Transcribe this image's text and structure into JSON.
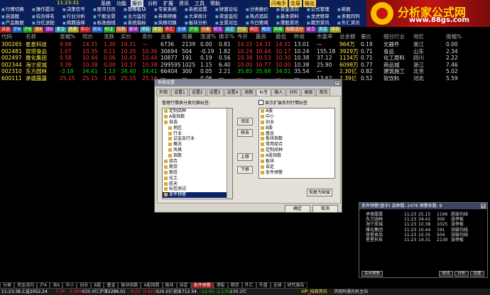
{
  "titlebar": {
    "time": "11:23:31",
    "menu": [
      "系统",
      "功能",
      "报价",
      "分析",
      "扩展",
      "资讯",
      "工具",
      "帮助"
    ],
    "right": [
      "闪电手",
      "交易",
      "输出"
    ]
  },
  "toolbar": {
    "items": [
      "行情切换",
      "操作提示",
      "决策信号",
      "股市日历",
      "策略板块",
      "专家系统",
      "系统设置",
      "财富论坛",
      "分类报价",
      "资金流向",
      "公式管理",
      "新股",
      "自选股",
      "综合排名",
      "行业分析",
      "个股全景",
      "主力监控",
      "券商研报",
      "大单统计",
      "资金监控",
      "热点追踪",
      "基本资料",
      "龙虎榜单",
      "多股同列",
      "产品数据",
      "分红送配",
      "周期选择",
      "标准画线",
      "系统指标",
      "风格切换",
      "板块分析",
      "全景对比",
      "今日要闻",
      "港股资讯",
      "期货资讯",
      "外汇资讯"
    ]
  },
  "logo": {
    "title": "分析家公式网",
    "url": "www.88gs.com"
  },
  "strip": {
    "items": [
      "自选",
      "沪A",
      "沪B",
      "深A",
      "深B",
      "基金",
      "债券",
      "中小",
      "创业",
      "权证",
      "指数",
      "板块",
      "港股",
      "期货",
      "外汇",
      "全球",
      "沪深",
      "分类",
      "综合",
      "自定",
      "行业",
      "地区",
      "概念",
      "风格",
      "指数成分",
      "组合",
      "资金",
      "排名"
    ],
    "colors": [
      "#c02020",
      "#2060c0",
      "#20a020",
      "#c06020",
      "#8020a0",
      "#2090a0",
      "#a0a020"
    ]
  },
  "table": {
    "headers": [
      "代码",
      "名称",
      "涨幅%",
      "现价",
      "涨跌",
      "买价",
      "卖价",
      "总量",
      "现量",
      "涨速%",
      "换手%",
      "今开",
      "最高",
      "最低",
      "昨收",
      "市盈率",
      "总金额",
      "量比",
      "细分行业",
      "地区",
      "振幅%"
    ],
    "rows": [
      [
        "300265",
        "星星科技",
        "9.99",
        "14.31",
        "1.30",
        "14.31",
        "—",
        "6736",
        "2139",
        "0.00",
        "0.81",
        "14.31",
        "14.31",
        "14.31",
        "13.01",
        "—",
        "964万",
        "0.19",
        "光器件",
        "浙江",
        "0.00"
      ],
      [
        "002481",
        "双塔食品",
        "1.07",
        "10.35",
        "0.11",
        "10.35",
        "10.36",
        "30694",
        "504",
        "-0.19",
        "1.82",
        "10.24",
        "10.44",
        "10.17",
        "10.24",
        "155.18",
        "3929万",
        "0.71",
        "食品",
        "山东",
        "2.34"
      ],
      [
        "002497",
        "雅化集团",
        "0.58",
        "10.44",
        "0.06",
        "10.43",
        "10.44",
        "10877",
        "191",
        "0.19",
        "0.56",
        "10.38",
        "10.53",
        "10.30",
        "10.38",
        "37.12",
        "1134万",
        "0.71",
        "化工原料",
        "四川",
        "2.22"
      ],
      [
        "002344",
        "海宁皮城",
        "3.39",
        "10.38",
        "0.00",
        "10.37",
        "10.38",
        "299595",
        "1025",
        "1.15",
        "6.40",
        "10.00",
        "10.77",
        "10.00",
        "10.38",
        "25.90",
        "6098万",
        "0.77",
        "商品城",
        "浙江",
        "7.46"
      ],
      [
        "002310",
        "东方园林",
        "-3.18",
        "34.41",
        "1.13",
        "34.40",
        "34.41",
        "66404",
        "300",
        "0.05",
        "2.21",
        "35.85",
        "35.68",
        "34.01",
        "35.54",
        "—",
        "2.30亿",
        "0.82",
        "建筑施工",
        "北京",
        "5.02"
      ],
      [
        "600111",
        "承德露露",
        "25.15",
        "25.15",
        "1.65",
        "25.15",
        "25.16",
        "—",
        "—",
        "0.06",
        "—",
        "—",
        "—",
        "—",
        "—",
        "13.62",
        "2.39亿",
        "0.52",
        "软饮料",
        "河北",
        "5.59"
      ]
    ],
    "colors": {
      "up": "#ff3333",
      "down": "#00dd00",
      "flat": "#dddddd",
      "code": "#ffee44",
      "name": "#ffee44"
    }
  },
  "dialog": {
    "title": "系统设置",
    "tabs": [
      "外观",
      "设置1",
      "设置2",
      "设置3",
      "设置4",
      "周期",
      "标签",
      "输入",
      "分栏",
      "高级",
      "首页"
    ],
    "active_tab": "标签",
    "left_label": "管理行情表分类切换标签:",
    "left_items": [
      "定制品种",
      "A股指数",
      "自选",
      "地区",
      "行业",
      "证监会行业",
      "概念",
      "风格",
      "指数",
      "组合",
      "期货",
      "期货",
      "化工",
      "航天",
      "标签测试",
      "条件预警"
    ],
    "selected_left": "条件预警",
    "right_label": "显示扩展系列行情标签",
    "right_items": [
      "A股",
      "中小",
      "创业",
      "B股",
      "基金",
      "板块指数",
      "常用组合",
      "定制品种",
      "A股指数",
      "板块",
      "自定",
      "条件预警"
    ],
    "buttons": {
      "add": "添加",
      "remove": "移去",
      "up": "上移",
      "down": "下移",
      "restore": "恢复为缺省",
      "ok": "确定",
      "cancel": "取消"
    }
  },
  "warning": {
    "title": "条件预警(盘中)  品种数: 2476  预警条数: 9",
    "rows": [
      [
        "承德露露",
        "11:23",
        "25.15",
        "1196",
        "跌破均线"
      ],
      [
        "东方园林",
        "11:23",
        "34.41",
        "300",
        "涨停板"
      ],
      [
        "海宁皮城",
        "11:23",
        "10.38",
        "1025",
        "涨停板"
      ],
      [
        "雅化集团",
        "11:23",
        "10.44",
        "191",
        "突破均线"
      ],
      [
        "双塔食品",
        "11:23",
        "10.35",
        "504",
        "突破均线"
      ],
      [
        "星星科技",
        "11:23",
        "14.31",
        "2139",
        "涨停板"
      ]
    ],
    "close_btn": "关闭预警",
    "buttons": [
      "修改",
      "分析",
      "设置"
    ]
  },
  "tabbar": {
    "items": [
      "分类",
      "资金流向",
      "沪A",
      "深A",
      "中小",
      "创业",
      "B股",
      "基金",
      "板块指数",
      "A股指数",
      "板块",
      "自定",
      "条件预警",
      "港股",
      "期货",
      "外汇",
      "外盘",
      "全球",
      "研究报告"
    ],
    "active": "条件预警"
  },
  "status": {
    "items": [
      {
        "t": "11:23:38",
        "c": "#fff"
      },
      {
        "t": "上证2052.24",
        "c": "#fff"
      },
      {
        "t": "7.34",
        "c": "#ff3333"
      },
      {
        "t": "0.36%",
        "c": "#ff3333"
      },
      {
        "t": "630.4亿",
        "c": "#ddd"
      },
      {
        "t": "沪深2286.01",
        "c": "#fff"
      },
      {
        "t": "9.23",
        "c": "#ff3333"
      },
      {
        "t": "0.41%",
        "c": "#ff3333"
      },
      {
        "t": "626.6亿",
        "c": "#ddd"
      },
      {
        "t": "创业712.54",
        "c": "#fff"
      },
      {
        "t": "-13.43",
        "c": "#00dd00"
      },
      {
        "t": "-1.13%",
        "c": "#00dd00"
      },
      {
        "t": "230.2亿",
        "c": "#ddd"
      },
      {
        "t": "VIP_招商资讯",
        "c": "#ffee44"
      },
      {
        "t": "济南阿通光机主站",
        "c": "#ddd"
      }
    ]
  }
}
